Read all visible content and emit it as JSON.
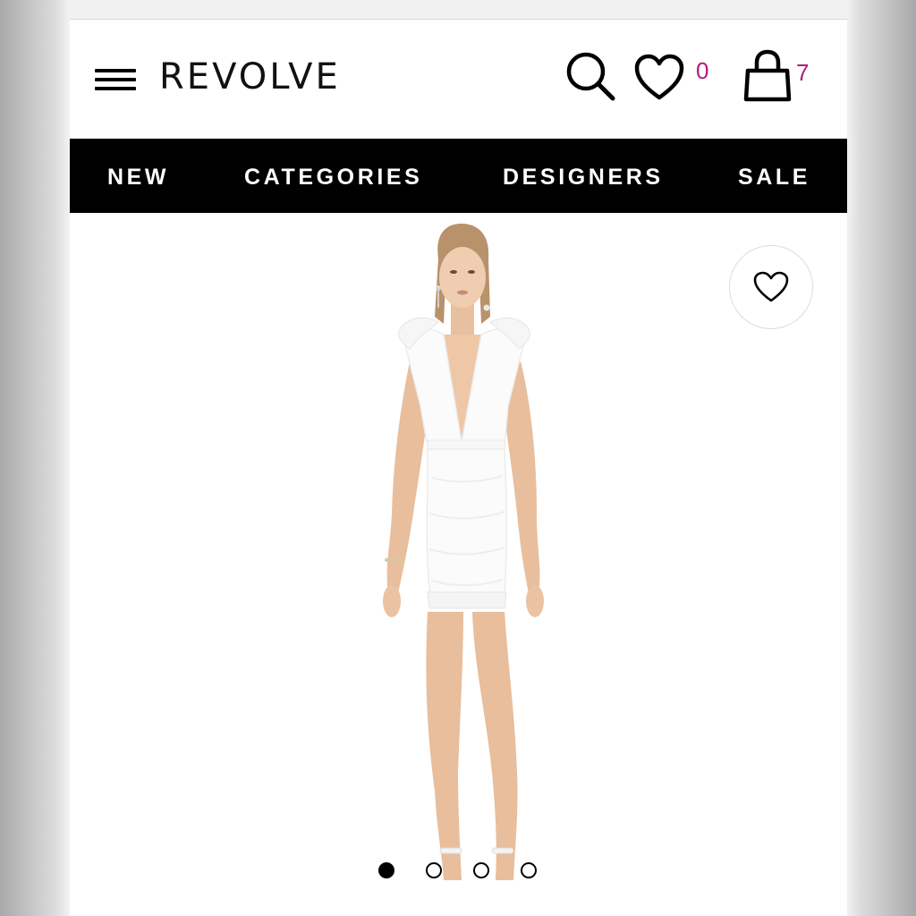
{
  "header": {
    "logo": "REVOLVE",
    "favorites_count": "0",
    "bag_count": "7"
  },
  "nav": {
    "items": [
      {
        "label": "NEW"
      },
      {
        "label": "CATEGORIES"
      },
      {
        "label": "DESIGNERS"
      },
      {
        "label": "SALE"
      }
    ]
  },
  "product": {
    "image_description": "model wearing white mini dress",
    "carousel": {
      "total_slides": 4,
      "active_index": 0
    }
  },
  "colors": {
    "accent_count": "#b01c80",
    "nav_background": "#000000",
    "page_background": "#ffffff"
  },
  "icons": [
    "menu-icon",
    "search-icon",
    "heart-icon",
    "bag-icon",
    "wishlist-heart-icon"
  ]
}
